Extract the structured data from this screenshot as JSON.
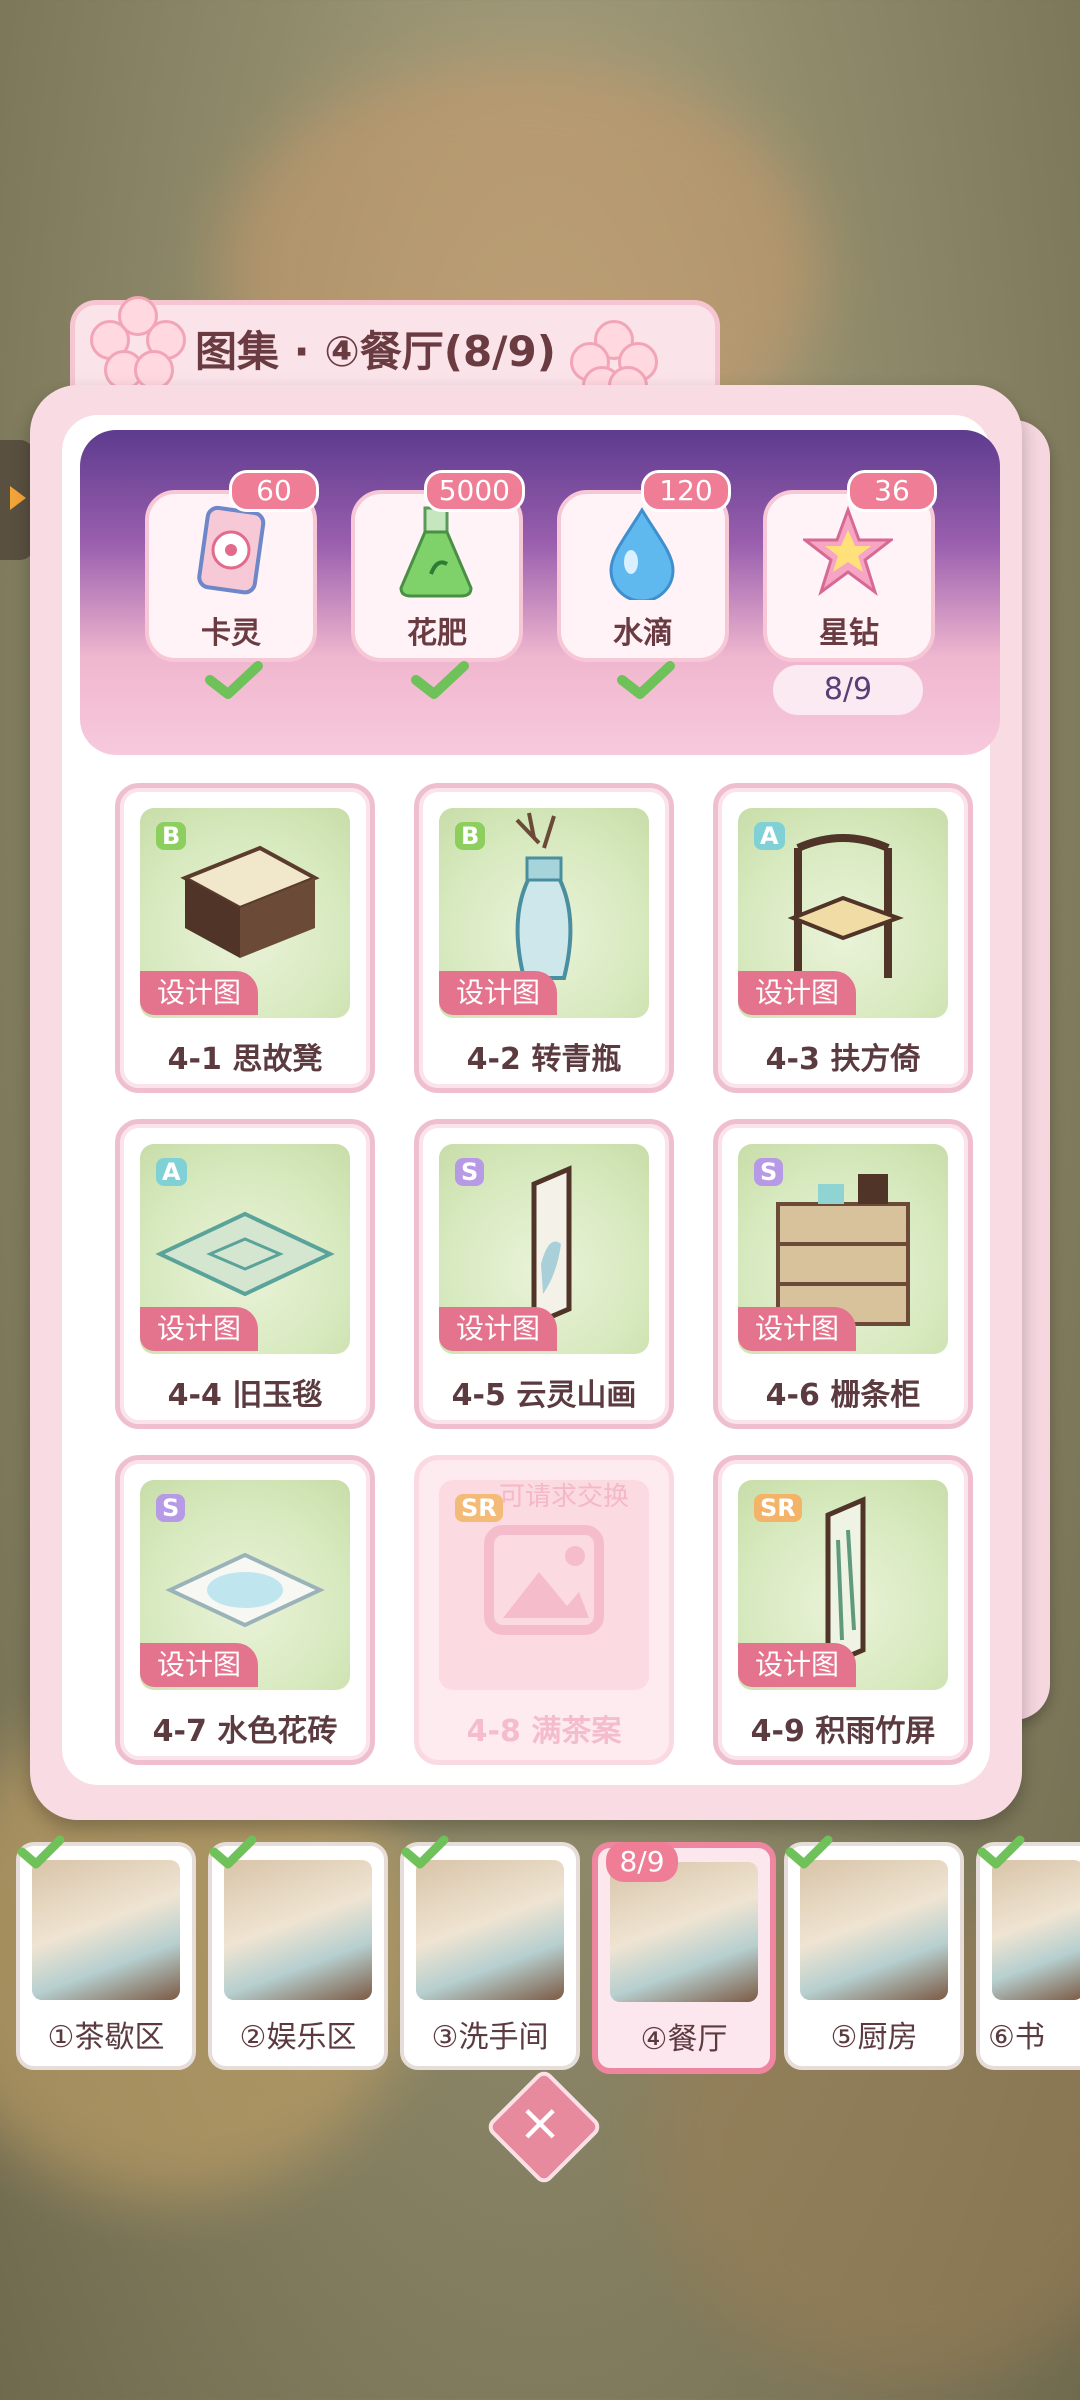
{
  "title": "图集 · ④餐厅(8/9)",
  "resources": [
    {
      "label": "卡灵",
      "count": "60",
      "icon": "card-spirit-icon",
      "done": true
    },
    {
      "label": "花肥",
      "count": "5000",
      "icon": "fertilizer-flask-icon",
      "done": true
    },
    {
      "label": "水滴",
      "count": "120",
      "icon": "water-drop-icon",
      "done": true
    },
    {
      "label": "星钻",
      "count": "36",
      "icon": "star-diamond-icon",
      "done": false
    }
  ],
  "collection_progress": "8/9",
  "items": [
    {
      "rank": "B",
      "label": "4-1 思故凳",
      "tag": "设计图",
      "locked": false
    },
    {
      "rank": "B",
      "label": "4-2 转青瓶",
      "tag": "设计图",
      "locked": false
    },
    {
      "rank": "A",
      "label": "4-3 扶方倚",
      "tag": "设计图",
      "locked": false
    },
    {
      "rank": "A",
      "label": "4-4 旧玉毯",
      "tag": "设计图",
      "locked": false
    },
    {
      "rank": "S",
      "label": "4-5 云灵山画",
      "tag": "设计图",
      "locked": false
    },
    {
      "rank": "S",
      "label": "4-6 栅条柜",
      "tag": "设计图",
      "locked": false
    },
    {
      "rank": "S",
      "label": "4-7 水色花砖",
      "tag": "设计图",
      "locked": false
    },
    {
      "rank": "SR",
      "label": "4-8 满茶案",
      "note": "可请求交换",
      "locked": true
    },
    {
      "rank": "SR",
      "label": "4-9 积雨竹屏",
      "tag": "设计图",
      "locked": false
    }
  ],
  "areas": [
    {
      "label": "①茶歇区",
      "done": true
    },
    {
      "label": "②娱乐区",
      "done": true
    },
    {
      "label": "③洗手间",
      "done": true
    },
    {
      "label": "④餐厅",
      "count": "8/9",
      "active": true
    },
    {
      "label": "⑤厨房",
      "done": true
    },
    {
      "label": "⑥书",
      "done": true
    }
  ],
  "colors": {
    "accent": "#ef7d95",
    "panel": "#f9dbe3",
    "check": "#7fcf6a"
  }
}
